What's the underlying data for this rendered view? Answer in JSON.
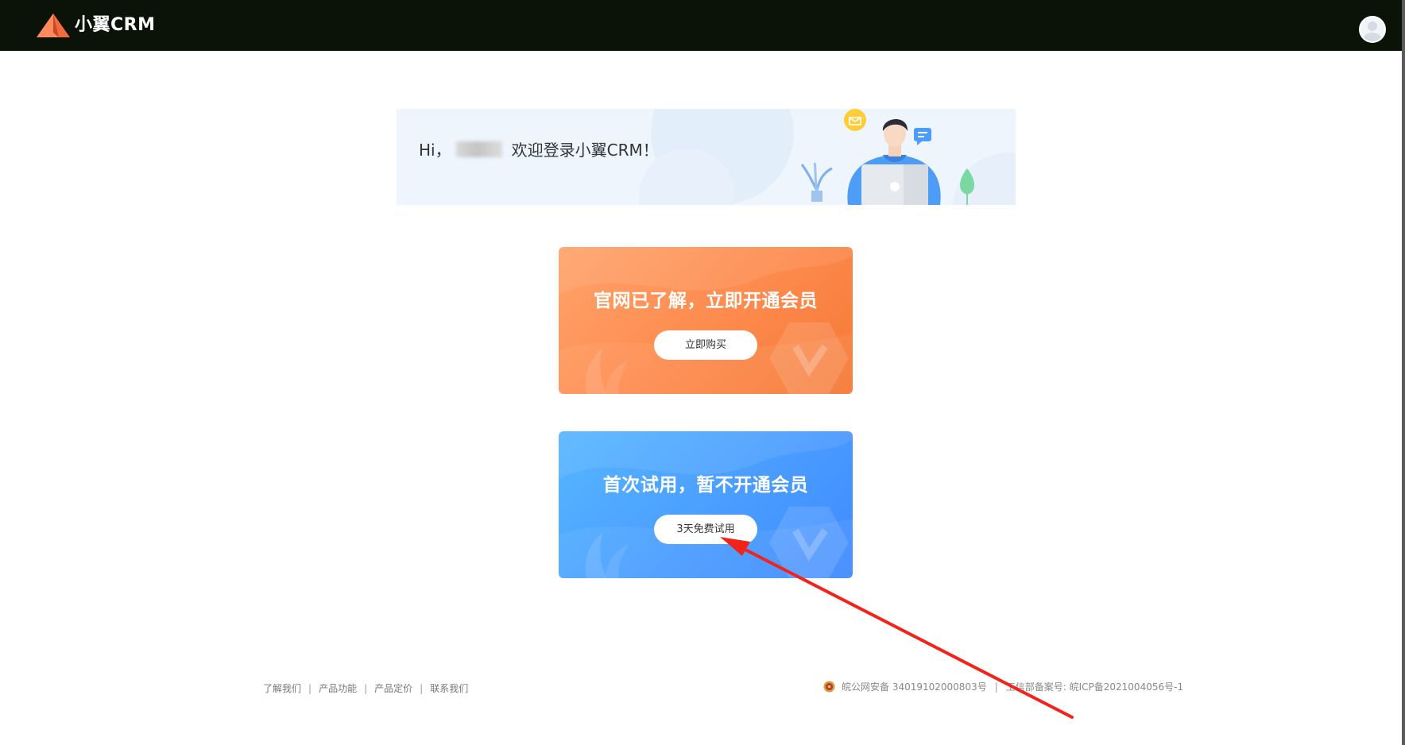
{
  "header": {
    "brand": "小翼CRM",
    "logo_icon": "triangle-logo-icon",
    "avatar_icon": "user-avatar-icon",
    "colors": {
      "background": "#0b1207",
      "logo": "#f26b3a"
    }
  },
  "banner": {
    "greeting": "Hi，",
    "welcome": "欢迎登录小翼CRM！",
    "illustration": "person-with-laptop-illustration"
  },
  "cards": [
    {
      "title": "官网已了解，立即开通会员",
      "button": "立即购买",
      "color": "#fd8a4d"
    },
    {
      "title": "首次试用，暂不开通会员",
      "button": "3天免费试用",
      "color": "#4a9dff"
    }
  ],
  "footer": {
    "links": [
      "了解我们",
      "产品功能",
      "产品定价",
      "联系我们"
    ],
    "separator": "|",
    "police_record": "皖公网安备 34019102000803号",
    "icp_record": "工信部备案号: 皖ICP备2021004056号-1",
    "police_icon": "police-badge-icon"
  },
  "annotation": {
    "type": "red-arrow",
    "color": "#f2231a"
  }
}
